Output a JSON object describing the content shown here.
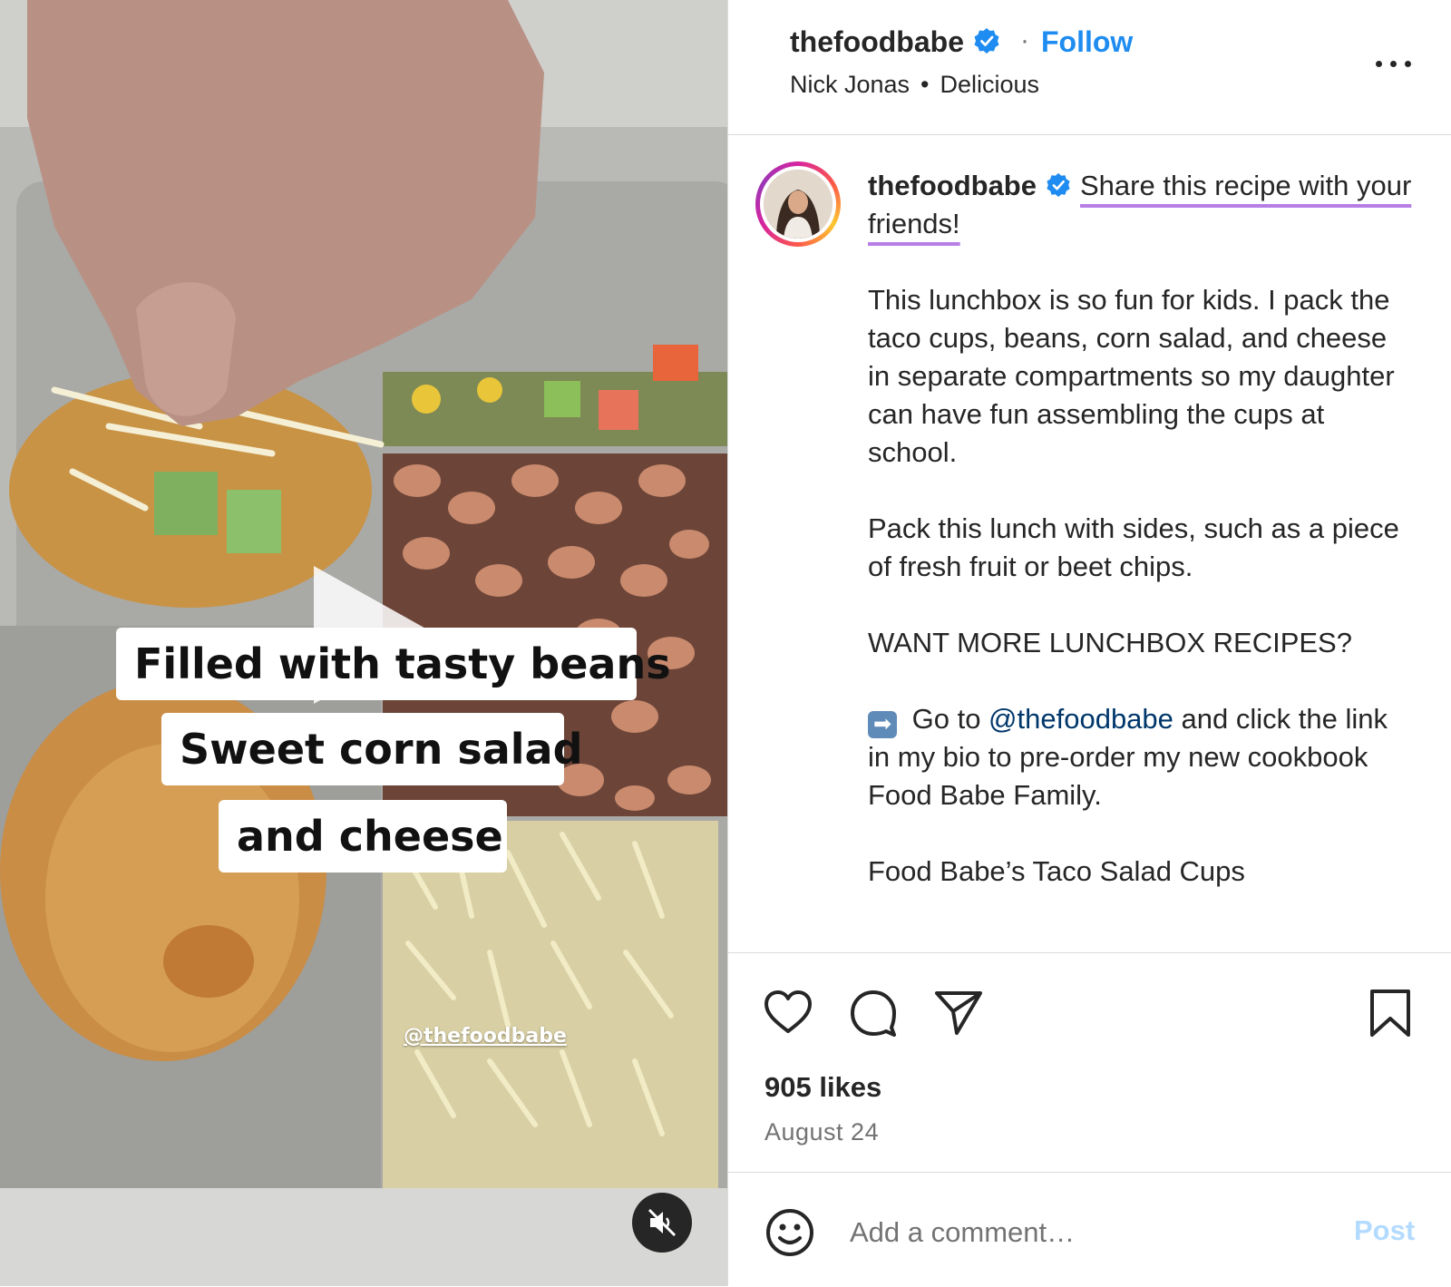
{
  "video": {
    "captions": [
      "Filled with tasty beans",
      "Sweet corn salad",
      "and cheese"
    ],
    "handle_overlay": "@thefoodbabe",
    "state": "paused",
    "muted": true
  },
  "header": {
    "username": "thefoodbabe",
    "verified": true,
    "separator": "·",
    "follow_label": "Follow",
    "audio_artist": "Nick Jonas",
    "audio_separator": "•",
    "audio_title": "Delicious"
  },
  "caption": {
    "username": "thefoodbabe",
    "lead": "Share this recipe with your friends!",
    "paragraph1": "This lunchbox is so fun for kids. I pack the taco cups, beans, corn salad, and cheese in separate compartments so my daughter can have fun assembling the cups at school.",
    "paragraph2": "Pack this lunch with sides, such as a piece of fresh fruit or beet chips.",
    "paragraph3": "WANT MORE LUNCHBOX RECIPES?",
    "p4_before": " Go to ",
    "p4_mention": "@thefoodbabe",
    "p4_after": " and click the link in my bio to pre-order my new cookbook Food Babe Family.",
    "paragraph5": "Food Babe’s Taco Salad Cups"
  },
  "actions": {
    "likes": "905 likes",
    "date": "August 24",
    "icons": [
      "heart-icon",
      "comment-icon",
      "share-icon",
      "bookmark-icon"
    ]
  },
  "comment": {
    "placeholder": "Add a comment…",
    "post_label": "Post"
  },
  "colors": {
    "accent_blue": "#1e8cf0",
    "mention_blue": "#00376b",
    "highlight_underline": "#b77fe6",
    "post_disabled": "#b3dbff"
  }
}
